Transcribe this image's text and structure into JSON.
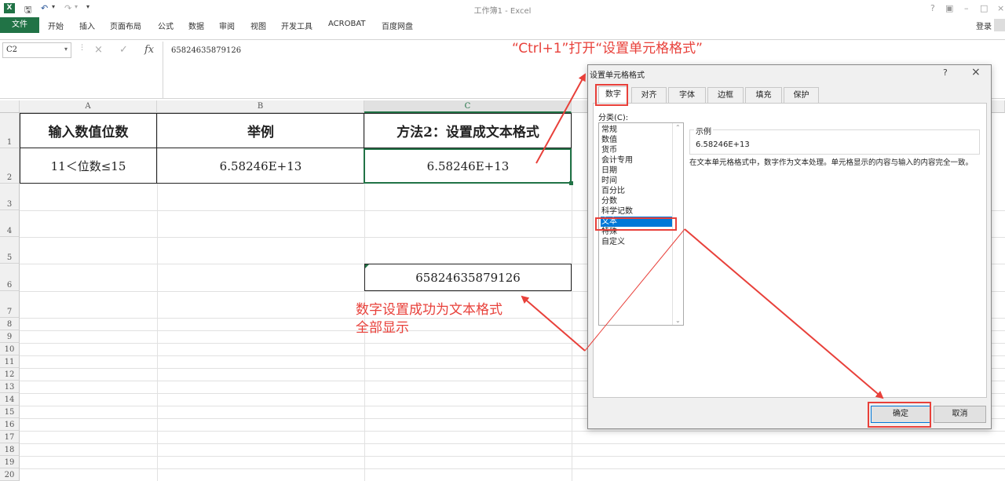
{
  "window": {
    "app_icon": "X",
    "title": "工作簿1 - Excel",
    "quick_access": [
      "save-icon",
      "undo-icon",
      "redo-icon",
      "customize-icon"
    ],
    "controls": [
      "?",
      "ribbon-display-icon",
      "_",
      "□",
      "×"
    ]
  },
  "ribbon": {
    "file": "文件",
    "tabs": [
      "开始",
      "插入",
      "页面布局",
      "公式",
      "数据",
      "审阅",
      "视图",
      "开发工具",
      "ACROBAT",
      "百度网盘"
    ],
    "login": "登录"
  },
  "formula_bar": {
    "name_box": "C2",
    "cancel": "×",
    "enter": "✓",
    "fx": "fx",
    "content": "65824635879126"
  },
  "sheet": {
    "columns": [
      "A",
      "B",
      "C"
    ],
    "selected_column": "C",
    "rows": [
      "1",
      "2",
      "3",
      "4",
      "5",
      "6",
      "7",
      "8",
      "9",
      "10",
      "11",
      "12",
      "13",
      "14",
      "15",
      "16",
      "17",
      "18",
      "19",
      "20"
    ],
    "table": {
      "headers": [
        "输入数值位数",
        "举例",
        "方法2：设置成文本格式"
      ],
      "row": [
        "11＜位数≤15",
        "6.58246E+13",
        "6.58246E+13"
      ]
    },
    "cell_c6": "65824635879126"
  },
  "annotations": {
    "shortcut": "“Ctrl+1”打开“设置单元格格式”",
    "success_line1": "数字设置成功为文本格式",
    "success_line2": "全部显示"
  },
  "dialog": {
    "title": "设置单元格格式",
    "help": "?",
    "close": "×",
    "tabs": [
      "数字",
      "对齐",
      "字体",
      "边框",
      "填充",
      "保护"
    ],
    "active_tab": "数字",
    "category_label": "分类(C):",
    "categories": [
      "常规",
      "数值",
      "货币",
      "会计专用",
      "日期",
      "时间",
      "百分比",
      "分数",
      "科学记数",
      "文本",
      "特殊",
      "自定义"
    ],
    "selected_category": "文本",
    "sample_label": "示例",
    "sample_value": "6.58246E+13",
    "description": "在文本单元格格式中，数字作为文本处理。单元格显示的内容与输入的内容完全一致。",
    "ok": "确定",
    "cancel": "取消"
  },
  "colors": {
    "excel_green": "#217346",
    "annotation_red": "#e8403a",
    "selection_blue": "#0078d7"
  }
}
